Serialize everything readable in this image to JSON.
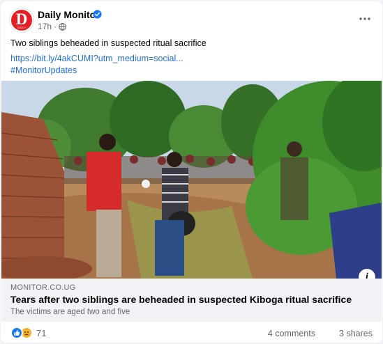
{
  "post": {
    "page_name": "Daily Monitor",
    "avatar_letter": "D",
    "avatar_sub": "DAILY MONITOR",
    "time": "17h",
    "time_dot": "·",
    "text": "Two siblings beheaded in suspected ritual sacrifice",
    "link": "https://bit.ly/4akCUMI?utm_medium=social...",
    "hashtag": "#MonitorUpdates"
  },
  "preview": {
    "domain": "MONITOR.CO.UG",
    "headline": "Tears after two siblings are beheaded in suspected Kiboga ritual sacrifice",
    "subline": "The victims are aged two and five",
    "info": "i"
  },
  "footer": {
    "reaction_count": "71",
    "comments": "4 comments",
    "shares": "3 shares"
  },
  "icons": {
    "verified": "verified-badge-icon",
    "globe": "globe-icon",
    "more": "more-options-icon",
    "like": "like-reaction-icon",
    "sad": "sad-reaction-icon"
  },
  "colors": {
    "brand_red": "#e41e26",
    "link_blue": "#216fdb",
    "facebook_blue": "#1877f2",
    "muted_text": "#65676b"
  }
}
